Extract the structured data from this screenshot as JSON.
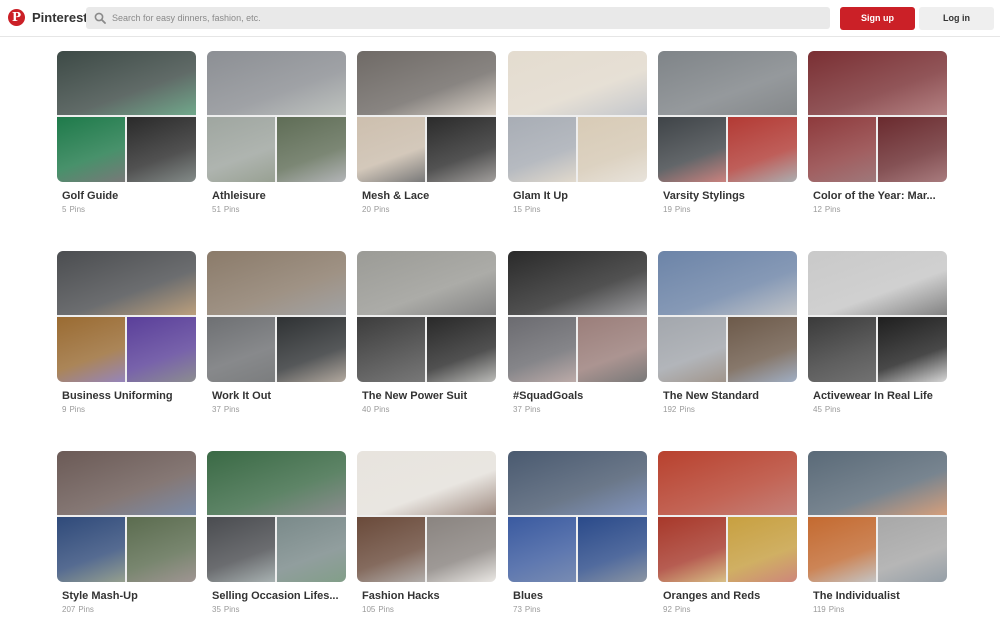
{
  "header": {
    "brand": "Pinterest",
    "logo_letter": "P",
    "search_placeholder": "Search for easy dinners, fashion, etc.",
    "signup_label": "Sign up",
    "login_label": "Log in",
    "accent": "#cb2027"
  },
  "pins_label": "Pins",
  "boards": [
    {
      "title": "Golf Guide",
      "count": "5",
      "colors": [
        "#3d4a46",
        "#1e7a4a",
        "#2a2a2a"
      ]
    },
    {
      "title": "Athleisure",
      "count": "51",
      "colors": [
        "#8c8f94",
        "#9fa6a0",
        "#5f6d56"
      ]
    },
    {
      "title": "Mesh & Lace",
      "count": "20",
      "colors": [
        "#6f6a66",
        "#cdbfae",
        "#2b2b2b"
      ]
    },
    {
      "title": "Glam It Up",
      "count": "15",
      "colors": [
        "#e4dccf",
        "#a8adb5",
        "#d8cbb6"
      ]
    },
    {
      "title": "Varsity Stylings",
      "count": "19",
      "colors": [
        "#7f8488",
        "#3f4448",
        "#b33a34"
      ]
    },
    {
      "title": "Color of the Year: Mar...",
      "count": "12",
      "colors": [
        "#7a2f33",
        "#8e3a3c",
        "#6a2a2e"
      ]
    },
    {
      "title": "Business Uniforming",
      "count": "9",
      "colors": [
        "#4b4d50",
        "#9a6b32",
        "#5a3f9a"
      ]
    },
    {
      "title": "Work It Out",
      "count": "37",
      "colors": [
        "#8b7b6a",
        "#6e7073",
        "#2f3234"
      ]
    },
    {
      "title": "The New Power Suit",
      "count": "40",
      "colors": [
        "#9b9b96",
        "#3c3c3c",
        "#292929"
      ]
    },
    {
      "title": "#SquadGoals",
      "count": "37",
      "colors": [
        "#2a2a2a",
        "#6b6b70",
        "#9b7e7a"
      ]
    },
    {
      "title": "The New Standard",
      "count": "192",
      "colors": [
        "#6c84a8",
        "#a3a7ad",
        "#6d5a4a"
      ]
    },
    {
      "title": "Activewear In Real Life",
      "count": "45",
      "colors": [
        "#c9c9c9",
        "#3a3a3a",
        "#1f1f1f"
      ]
    },
    {
      "title": "Style Mash-Up",
      "count": "207",
      "colors": [
        "#6b5a56",
        "#2f4a7a",
        "#5b6c4f"
      ]
    },
    {
      "title": "Selling Occasion Lifes...",
      "count": "35",
      "colors": [
        "#3a6a45",
        "#4a4c50",
        "#7a8a8a"
      ]
    },
    {
      "title": "Fashion Hacks",
      "count": "105",
      "colors": [
        "#e8e4de",
        "#6a4a3a",
        "#8a8480"
      ]
    },
    {
      "title": "Blues",
      "count": "73",
      "colors": [
        "#4a5a70",
        "#3a5aa0",
        "#2a4a8a"
      ]
    },
    {
      "title": "Oranges and Reds",
      "count": "92",
      "colors": [
        "#b8412e",
        "#a8382a",
        "#c8a040"
      ]
    },
    {
      "title": "The Individualist",
      "count": "119",
      "colors": [
        "#5a6a78",
        "#c46a30",
        "#a8a8a8"
      ]
    }
  ]
}
